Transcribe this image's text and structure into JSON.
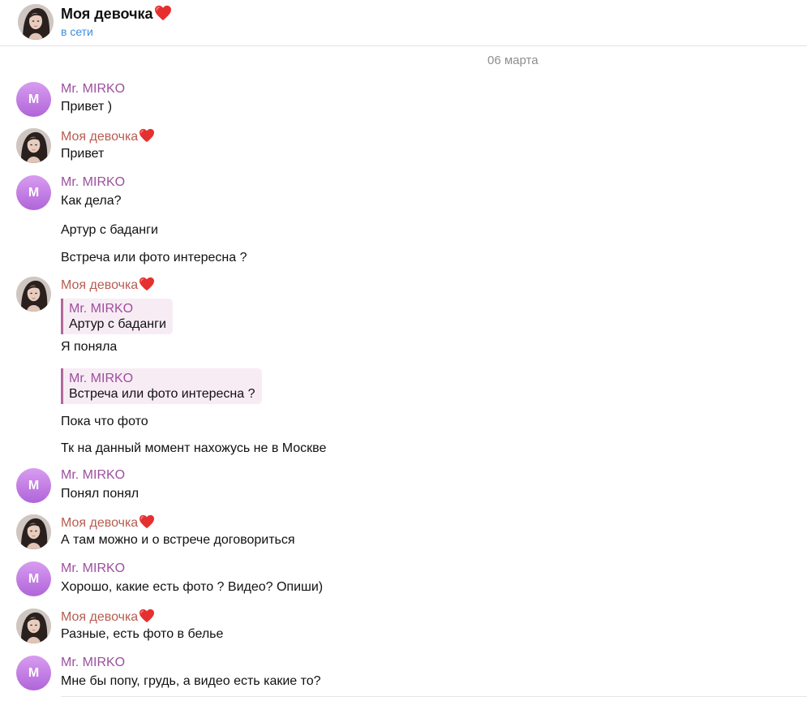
{
  "header": {
    "title": "Моя девочка",
    "status": "в сети"
  },
  "date_divider": "06 марта",
  "contacts": {
    "mirko": {
      "name": "Mr. MIRKO",
      "initial": "M"
    },
    "girl": {
      "name": "Моя девочка"
    }
  },
  "messages": [
    {
      "sender": "Mr. MIRKO",
      "lines": [
        "Привет )"
      ]
    },
    {
      "sender": "Моя девочка",
      "lines": [
        "Привет"
      ]
    },
    {
      "sender": "Mr. MIRKO",
      "lines": [
        "Как дела?",
        "Артур с баданги",
        "Встреча или фото интересна ?"
      ]
    },
    {
      "sender": "Моя девочка",
      "reply1": {
        "name": "Mr. MIRKO",
        "text": "Артур с баданги"
      },
      "line1": "Я поняла",
      "reply2": {
        "name": "Mr. MIRKO",
        "text": "Встреча или фото интересна ?"
      },
      "line2": "Пока что фото",
      "line3": "Тк на данный момент нахожусь не в Москве"
    },
    {
      "sender": "Mr. MIRKO",
      "lines": [
        "Понял понял"
      ]
    },
    {
      "sender": "Моя девочка",
      "lines": [
        "А там можно и о встрече договориться"
      ]
    },
    {
      "sender": "Mr. MIRKO",
      "lines": [
        "Хорошо, какие есть фото ? Видео? Опиши)"
      ]
    },
    {
      "sender": "Моя девочка",
      "lines": [
        "Разные, есть фото в белье"
      ]
    },
    {
      "sender": "Mr. MIRKO",
      "lines": [
        "Мне бы попу, грудь, а видео есть какие то?"
      ]
    }
  ],
  "colors": {
    "mirko_name": "#9c4f9e",
    "girl_name": "#b75c50",
    "status": "#3d8de0",
    "reply_bg": "#f8ecf4",
    "reply_bar": "#b0689c"
  },
  "icons": [
    "heart-emoji-icon",
    "avatar-photo"
  ]
}
